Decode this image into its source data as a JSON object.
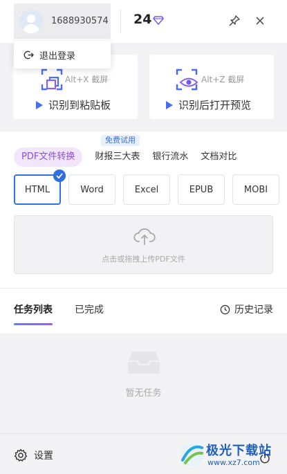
{
  "header": {
    "username": "1688930574",
    "points": "24"
  },
  "logout_menu": {
    "label": "退出登录"
  },
  "tiles": [
    {
      "hotkey": "Alt+X 截屏",
      "action": "识别到粘贴板"
    },
    {
      "hotkey": "Alt+Z 截屏",
      "action": "识别后打开预览"
    }
  ],
  "conversion": {
    "free_badge": "免费试用",
    "tabs": [
      "PDF文件转换",
      "财报三大表",
      "银行流水",
      "文档对比"
    ],
    "active_tab": "PDF文件转换",
    "formats": [
      "HTML",
      "Word",
      "Excel",
      "EPUB",
      "MOBI"
    ],
    "selected_format": "HTML",
    "upload_hint": "点击或拖拽上传PDF文件"
  },
  "tasks": {
    "tabs": [
      "任务列表",
      "已完成"
    ],
    "active_tab": "任务列表",
    "history_label": "历史记录",
    "empty_text": "暂无任务"
  },
  "footer": {
    "settings_label": "设置"
  },
  "watermark": {
    "title": "极光下载站",
    "url": "www.xz7.com"
  },
  "colors": {
    "accent_blue": "#2f6fe0",
    "accent_purple": "#8b4fd6",
    "gem_purple": "#7b5cf0"
  },
  "icons": [
    "user-avatar",
    "gem-icon",
    "pin-icon",
    "close-icon",
    "logout-icon",
    "screenshot-icon",
    "eye-icon",
    "play-icon",
    "check-icon",
    "cloud-upload-icon",
    "clock-icon",
    "inbox-icon",
    "gear-icon",
    "power-icon"
  ]
}
